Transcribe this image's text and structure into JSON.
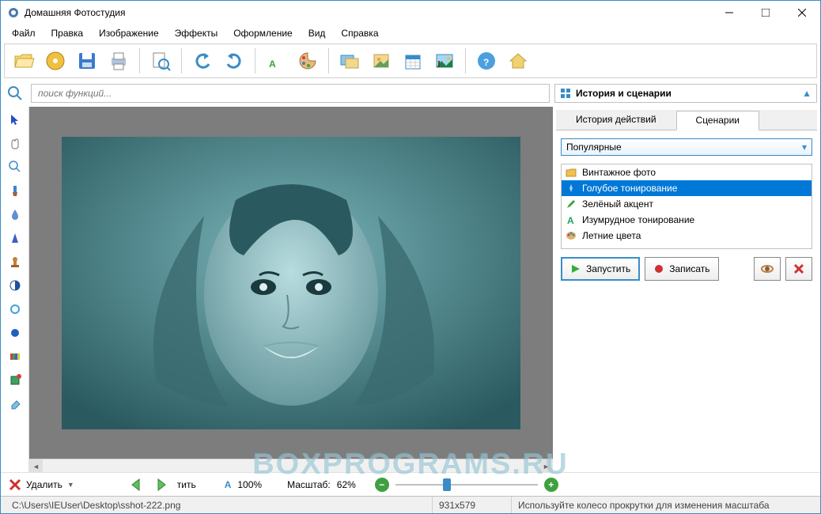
{
  "window": {
    "title": "Домашняя Фотостудия"
  },
  "menu": [
    "Файл",
    "Правка",
    "Изображение",
    "Эффекты",
    "Оформление",
    "Вид",
    "Справка"
  ],
  "toolbar_icons": [
    "open",
    "cd",
    "save",
    "print",
    "preview",
    "undo",
    "redo",
    "text",
    "palette",
    "image1",
    "image2",
    "calendar",
    "landscape",
    "help",
    "home"
  ],
  "search": {
    "placeholder": "поиск функций..."
  },
  "right_header": {
    "title": "История и сценарии"
  },
  "tabs": {
    "history": "История действий",
    "scenarios": "Сценарии",
    "active": 1
  },
  "dropdown": {
    "selected": "Популярные"
  },
  "scenarios": [
    {
      "label": "Винтажное фото",
      "icon": "folder"
    },
    {
      "label": "Голубое тонирование",
      "icon": "bluefx",
      "selected": true
    },
    {
      "label": "Зелёный акцент",
      "icon": "pencil"
    },
    {
      "label": "Изумрудное тонирование",
      "icon": "letterA"
    },
    {
      "label": "Летние цвета",
      "icon": "palette"
    }
  ],
  "actions": {
    "run": "Запустить",
    "record": "Записать"
  },
  "bottom": {
    "delete": "Удалить",
    "fit_prefix": "тить",
    "a100": "100%",
    "scale_label": "Масштаб:",
    "scale_value": "62%"
  },
  "status": {
    "path": "C:\\Users\\IEUser\\Desktop\\sshot-222.png",
    "dims": "931x579",
    "hint": "Используйте колесо прокрутки для изменения масштаба"
  },
  "watermark": "BOXPROGRAMS.RU"
}
